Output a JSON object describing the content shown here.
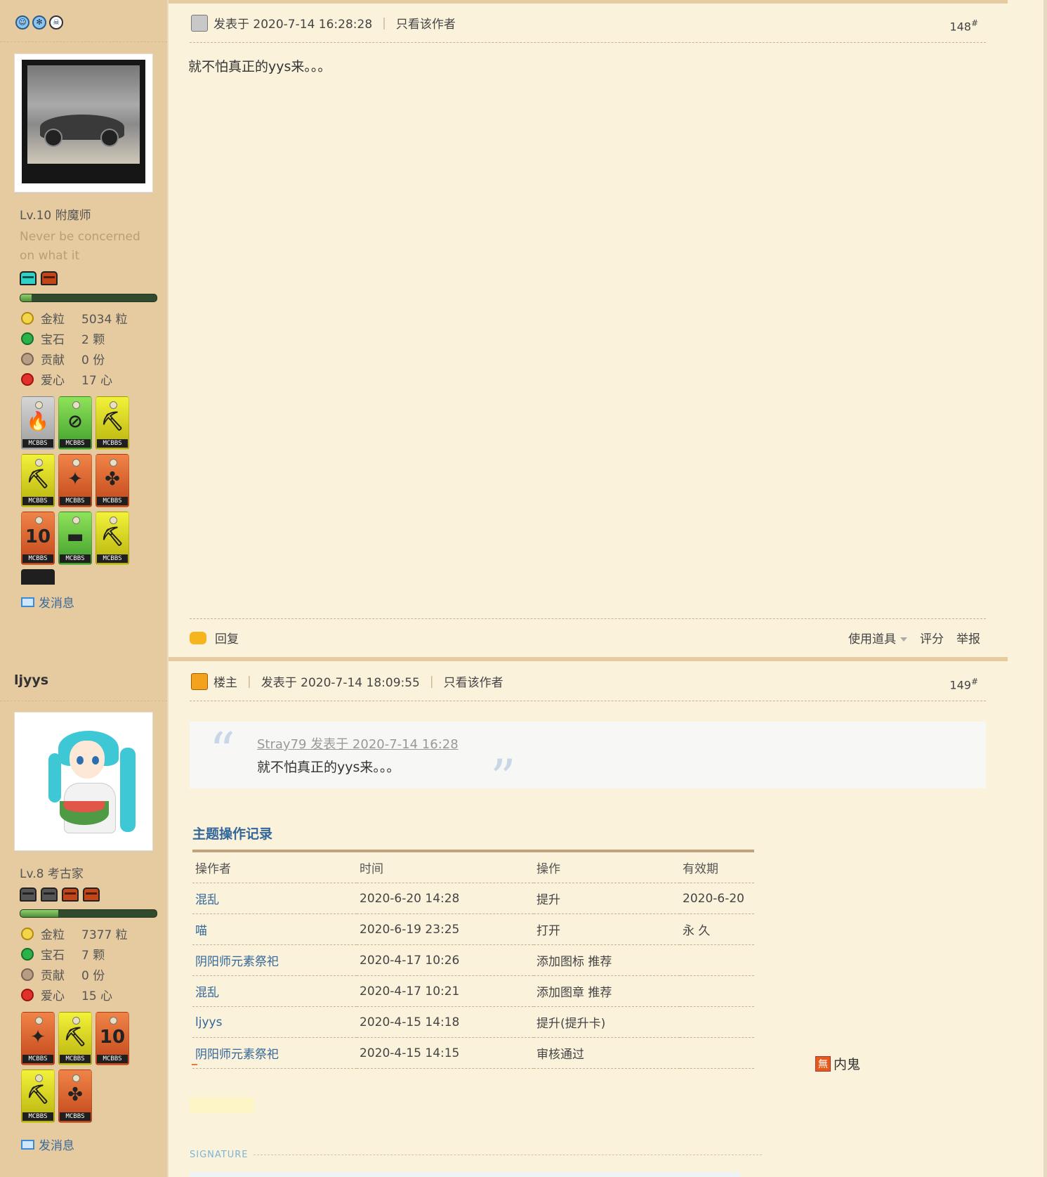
{
  "posts": [
    {
      "user": {
        "username": "",
        "level": "Lv.10 附魔师",
        "motto": "Never be concerned on what it",
        "stats": [
          {
            "icon": "gold-grain-icon",
            "label": "金粒",
            "value": "5034 粒"
          },
          {
            "icon": "gem-icon",
            "label": "宝石",
            "value": "2 颗"
          },
          {
            "icon": "contribution-icon",
            "label": "贡献",
            "value": "0 份"
          },
          {
            "icon": "heart-apple-icon",
            "label": "爱心",
            "value": "17 心"
          }
        ],
        "progress": 0.08,
        "medals": [
          {
            "color": "grey",
            "tag": "MCBBS",
            "glyph": "🔥"
          },
          {
            "color": "green",
            "tag": "MCBBS",
            "glyph": "⊘"
          },
          {
            "color": "yellow",
            "tag": "MCBBS",
            "glyph": "⛏"
          },
          {
            "color": "yellow",
            "tag": "MCBBS",
            "glyph": "⛏"
          },
          {
            "color": "orange",
            "tag": "MCBBS",
            "glyph": "✦"
          },
          {
            "color": "orange",
            "tag": "MCBBS",
            "glyph": "✤"
          },
          {
            "color": "orange",
            "tag": "MCBBS",
            "glyph": "10"
          },
          {
            "color": "green",
            "tag": "MCBBS",
            "glyph": "▬"
          },
          {
            "color": "yellow",
            "tag": "MCBBS",
            "glyph": "⛏"
          }
        ],
        "send_message": "发消息"
      },
      "meta": {
        "author_tag": "",
        "posted_at": "发表于 2020-7-14 16:28:28",
        "only_author": "只看该作者",
        "floor": "148",
        "floor_sup": "#"
      },
      "body": "就不怕真正的yys来。。。",
      "footer": {
        "reply": "回复",
        "use_item": "使用道具",
        "rate": "评分",
        "report": "举报"
      }
    },
    {
      "user": {
        "username": "ljyys",
        "level": "Lv.8 考古家",
        "stats": [
          {
            "icon": "gold-grain-icon",
            "label": "金粒",
            "value": "7377 粒"
          },
          {
            "icon": "gem-icon",
            "label": "宝石",
            "value": "7 颗"
          },
          {
            "icon": "contribution-icon",
            "label": "贡献",
            "value": "0 份"
          },
          {
            "icon": "heart-apple-icon",
            "label": "爱心",
            "value": "15 心"
          }
        ],
        "progress": 0.28,
        "medals": [
          {
            "color": "orange",
            "tag": "MCBBS",
            "glyph": "✦"
          },
          {
            "color": "yellow",
            "tag": "MCBBS",
            "glyph": "⛏"
          },
          {
            "color": "orange",
            "tag": "MCBBS",
            "glyph": "10"
          },
          {
            "color": "yellow",
            "tag": "MCBBS",
            "glyph": "⛏"
          },
          {
            "color": "orange",
            "tag": "MCBBS",
            "glyph": "✤"
          }
        ],
        "send_message": "发消息"
      },
      "meta": {
        "author_tag": "楼主",
        "posted_at": "发表于 2020-7-14 18:09:55",
        "only_author": "只看该作者",
        "floor": "149",
        "floor_sup": "#"
      },
      "quote": {
        "source": "Stray79 发表于 2020-7-14 16:28",
        "text": "就不怕真正的yys来。。。"
      },
      "op_log": {
        "title": "主题操作记录",
        "headers": [
          "操作者",
          "时间",
          "操作",
          "有效期"
        ],
        "rows": [
          [
            "混乱",
            "2020-6-20 14:28",
            "提升",
            "2020-6-20"
          ],
          [
            "喵",
            "2020-6-19 23:25",
            "打开",
            "永 久"
          ],
          [
            "阴阳师元素祭祀",
            "2020-4-17 10:26",
            "添加图标 推荐",
            ""
          ],
          [
            "混乱",
            "2020-4-17 10:21",
            "添加图章 推荐",
            ""
          ],
          [
            "ljyys",
            "2020-4-15 14:18",
            "提升(提升卡)",
            ""
          ],
          [
            "阴阳师元素祭祀",
            "2020-4-15 14:15",
            "审核通过",
            ""
          ]
        ]
      },
      "badge": {
        "icon_text": "無",
        "label": "内鬼"
      },
      "signature_label": "SIGNATURE"
    }
  ]
}
